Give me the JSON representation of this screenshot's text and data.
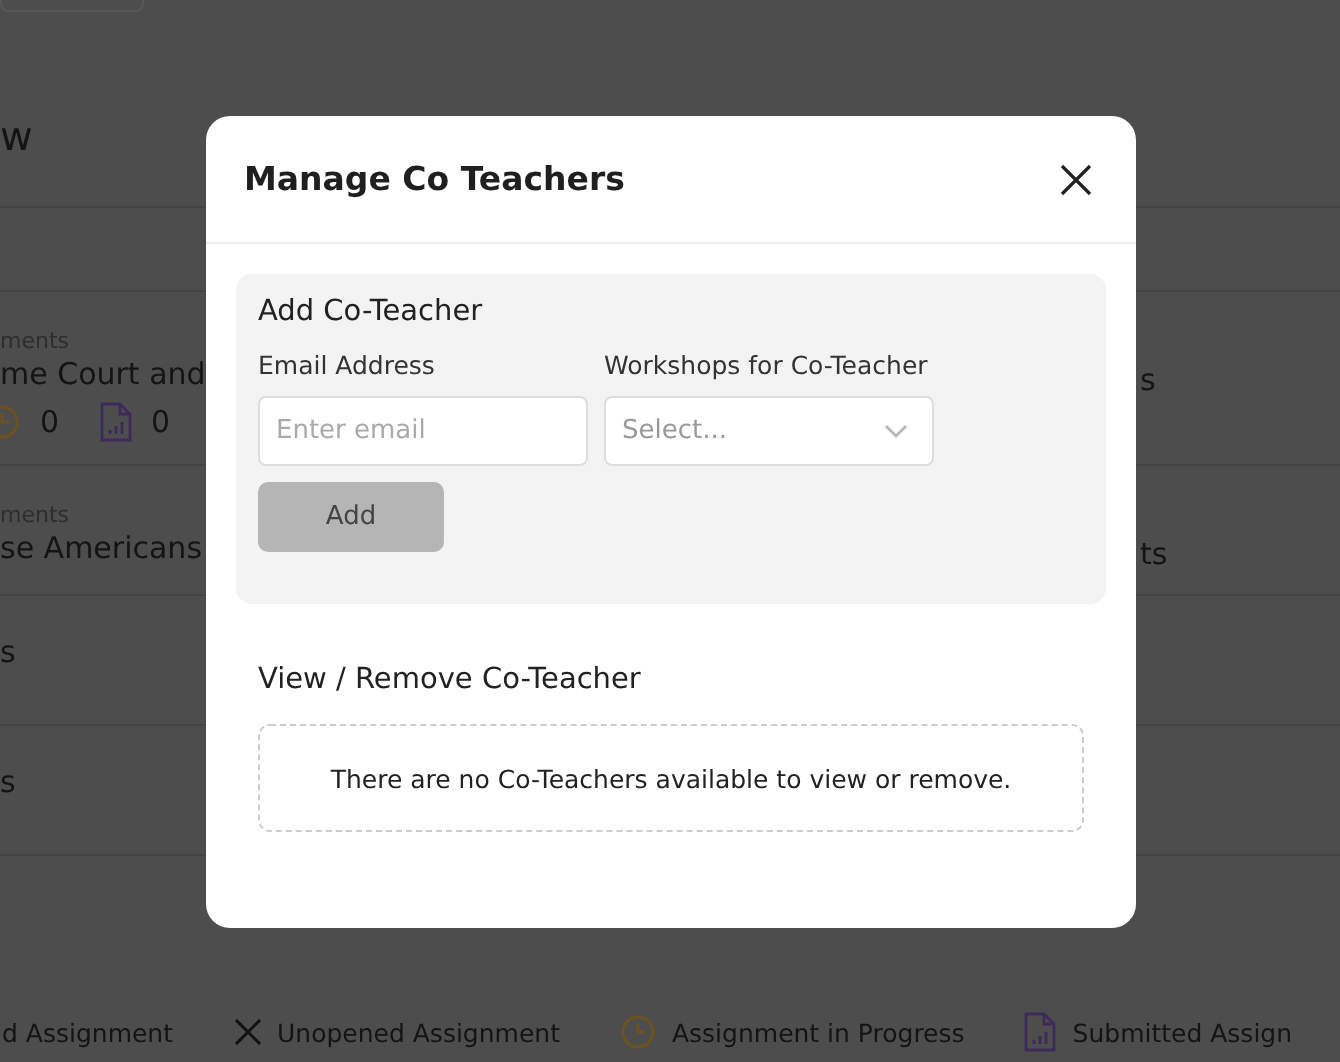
{
  "background": {
    "heading": "w",
    "rows": [
      {
        "label": "ments",
        "title": "me Court and",
        "right": "s",
        "stats": [
          {
            "kind": "progress",
            "value": "0"
          },
          {
            "kind": "submitted",
            "value": "0"
          }
        ]
      },
      {
        "label": "ments",
        "title": "se Americans",
        "right": "ts",
        "stats": []
      },
      {
        "label": "",
        "title": "s",
        "right": "",
        "stats": []
      },
      {
        "label": "",
        "title": "s",
        "right": "",
        "stats": []
      }
    ],
    "legend": [
      {
        "kind": "opened",
        "label": "d Assignment"
      },
      {
        "kind": "unopened",
        "label": "Unopened Assignment"
      },
      {
        "kind": "progress",
        "label": "Assignment in Progress"
      },
      {
        "kind": "submitted",
        "label": "Submitted Assign"
      }
    ]
  },
  "modal": {
    "title": "Manage Co Teachers",
    "add_section": {
      "title": "Add Co-Teacher",
      "email_label": "Email Address",
      "email_placeholder": "Enter email",
      "workshops_label": "Workshops for Co-Teacher",
      "workshops_placeholder": "Select...",
      "add_button": "Add",
      "add_disabled": true
    },
    "view_section": {
      "title": "View / Remove Co-Teacher",
      "empty_message": "There are no Co-Teachers available to view or remove."
    }
  }
}
